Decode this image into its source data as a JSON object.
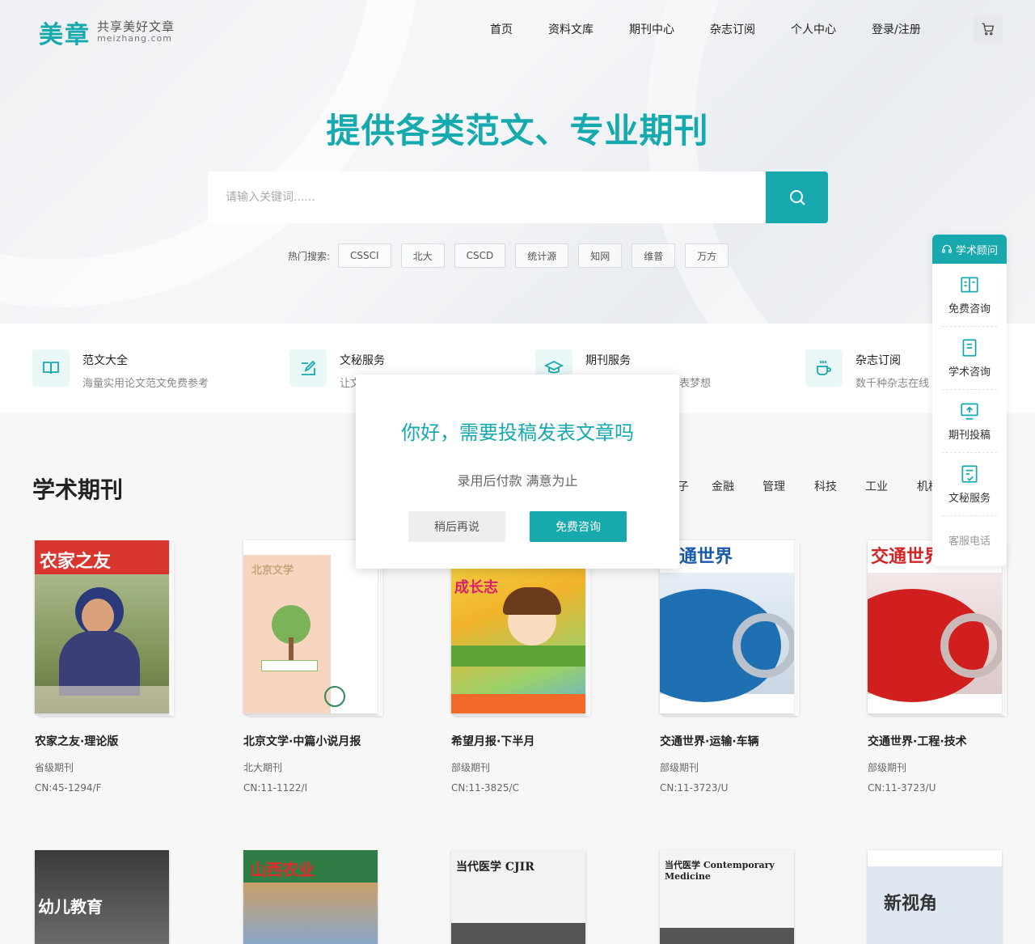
{
  "brand": {
    "logo_main": "美章",
    "logo_tagline": "共享美好文章",
    "logo_domain": "meizhang.com",
    "accent": "#17a9ae"
  },
  "nav": {
    "items": [
      "首页",
      "资料文库",
      "期刊中心",
      "杂志订阅",
      "个人中心",
      "登录/注册"
    ],
    "cart_icon": "cart-icon"
  },
  "hero": {
    "headline": "提供各类范文、专业期刊",
    "search_placeholder": "请输入关键词......",
    "search_icon": "search-icon",
    "hot_label": "热门搜索:",
    "hot_tags": [
      "CSSCI",
      "北大",
      "CSCD",
      "统计源",
      "知网",
      "维普",
      "万方"
    ]
  },
  "services": [
    {
      "title": "范文大全",
      "desc": "海量实用论文范文免费参考",
      "icon": "book-icon"
    },
    {
      "title": "文秘服务",
      "desc": "让文",
      "icon": "edit-icon"
    },
    {
      "title": "期刊服务",
      "desc": "现发表梦想",
      "icon": "graduation-cap-icon"
    },
    {
      "title": "杂志订阅",
      "desc": "数千种杂志在线",
      "icon": "coffee-cup-icon"
    }
  ],
  "journals": {
    "section_title": "学术期刊",
    "categories": [
      "金融",
      "管理",
      "科技",
      "工业",
      "机械"
    ],
    "items": [
      {
        "name": "农家之友·理论版",
        "level": "省级期刊",
        "cn": "CN:45-1294/F",
        "cover_text": "农家之友"
      },
      {
        "name": "北京文学·中篇小说月报",
        "level": "北大期刊",
        "cn": "CN:11-1122/I",
        "cover_text": "北京文学"
      },
      {
        "name": "希望月报·下半月",
        "level": "部级期刊",
        "cn": "CN:11-3825/C",
        "cover_text": "成长志"
      },
      {
        "name": "交通世界·运输·车辆",
        "level": "部级期刊",
        "cn": "CN:11-3723/U",
        "cover_text": "交通世界"
      },
      {
        "name": "交通世界·工程·技术",
        "level": "部级期刊",
        "cn": "CN:11-3723/U",
        "cover_text": "交通世界"
      }
    ],
    "row2_covers": [
      "幼儿教育",
      "山西农业",
      "当代医学 CJIR",
      "当代医学 Contemporary Medicine",
      "新视角"
    ]
  },
  "side_panel": {
    "header": "学术顾问",
    "items": [
      "免费咨询",
      "学术咨询",
      "期刊投稿",
      "文秘服务"
    ],
    "footer": "客服电话"
  },
  "modal": {
    "title": "你好，需要投稿发表文章吗",
    "subtitle": "录用后付款 满意为止",
    "later_label": "稍后再说",
    "consult_label": "免费咨询"
  }
}
